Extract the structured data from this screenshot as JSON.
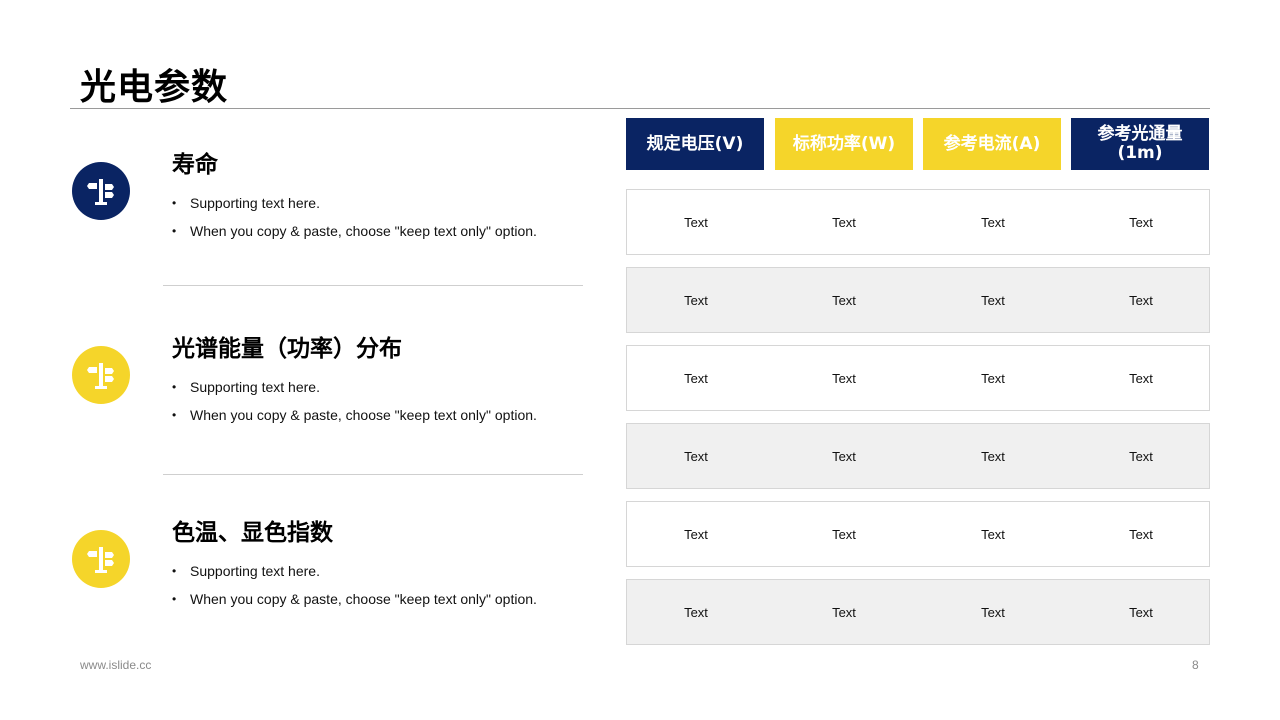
{
  "title": "光电参数",
  "colors": {
    "navy": "#0a2463",
    "yellow": "#f5d52a",
    "row_alt": "#f0f0f0"
  },
  "sections": [
    {
      "icon": "signpost-icon",
      "icon_color": "#0a2463",
      "title": "寿命",
      "bullets": [
        "Supporting text here.",
        "When you copy & paste, choose \"keep text only\" option."
      ]
    },
    {
      "icon": "signpost-icon",
      "icon_color": "#f5d52a",
      "title": "光谱能量（功率）分布",
      "bullets": [
        "Supporting text here.",
        "When you copy & paste, choose \"keep text only\" option."
      ]
    },
    {
      "icon": "signpost-icon",
      "icon_color": "#f5d52a",
      "title": "色温、显色指数",
      "bullets": [
        "Supporting text here.",
        "When you copy & paste, choose \"keep text only\" option."
      ]
    }
  ],
  "table": {
    "headers": [
      {
        "label": "规定电压(V)",
        "color": "#0a2463"
      },
      {
        "label": "标称功率(W)",
        "color": "#f5d52a"
      },
      {
        "label": "参考电流(A)",
        "color": "#f5d52a"
      },
      {
        "label": "参考光通量\n(1m)",
        "color": "#0a2463"
      }
    ],
    "rows": [
      [
        "Text",
        "Text",
        "Text",
        "Text"
      ],
      [
        "Text",
        "Text",
        "Text",
        "Text"
      ],
      [
        "Text",
        "Text",
        "Text",
        "Text"
      ],
      [
        "Text",
        "Text",
        "Text",
        "Text"
      ],
      [
        "Text",
        "Text",
        "Text",
        "Text"
      ],
      [
        "Text",
        "Text",
        "Text",
        "Text"
      ]
    ]
  },
  "footer": {
    "website": "www.islide.cc",
    "page_number": "8"
  }
}
